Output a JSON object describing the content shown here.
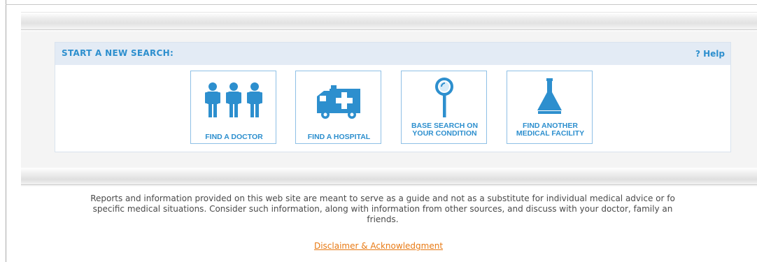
{
  "search_panel": {
    "title": "START A NEW SEARCH:",
    "help_label": "? Help"
  },
  "tiles": [
    {
      "label": "FIND A DOCTOR",
      "icon": "doctors-icon"
    },
    {
      "label": "FIND A HOSPITAL",
      "icon": "ambulance-icon"
    },
    {
      "label_lines": [
        "BASE SEARCH ON",
        "YOUR CONDITION"
      ],
      "icon": "magnifier-icon"
    },
    {
      "label_lines": [
        "FIND ANOTHER",
        "MEDICAL FACILITY"
      ],
      "icon": "flask-icon"
    }
  ],
  "footer": {
    "disclaimer_lines": [
      "Reports and information provided on this web site are meant to serve as a guide and not as a substitute for individual medical advice or fo",
      "specific medical situations. Consider such information, along with information from other sources, and discuss with your doctor, family an",
      "friends."
    ],
    "link_label": "Disclaimer & Acknowledgment"
  },
  "colors": {
    "accent_blue": "#2d8fce",
    "header_bg": "#e3ebf5",
    "link_orange": "#e87a14"
  }
}
